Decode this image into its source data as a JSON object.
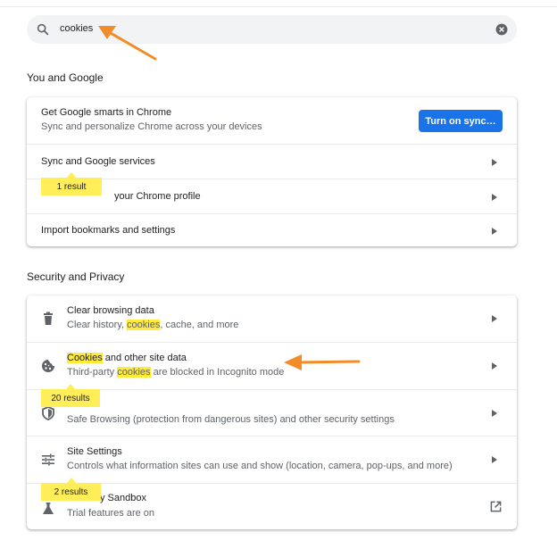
{
  "search": {
    "value": "cookies"
  },
  "you_and_google": {
    "title": "You and Google",
    "sync_card": {
      "title": "Get Google smarts in Chrome",
      "subtitle": "Sync and personalize Chrome across your devices",
      "button": "Turn on sync…"
    },
    "rows": [
      {
        "title": "Sync and Google services"
      },
      {
        "title_visible": "your Chrome profile"
      },
      {
        "title": "Import bookmarks and settings"
      }
    ],
    "bubble": "1 result"
  },
  "security": {
    "title": "Security and Privacy",
    "clear": {
      "title": "Clear browsing data",
      "sub_pre": "Clear history, ",
      "sub_hl": "cookies",
      "sub_post": ", cache, and more"
    },
    "cookies": {
      "title_hl": "Cookies",
      "title_post": " and other site data",
      "sub_pre": "Third-party ",
      "sub_hl": "cookies",
      "sub_post": " are blocked in Incognito mode"
    },
    "security_row": {
      "sub": "Safe Browsing (protection from dangerous sites) and other security settings"
    },
    "site_settings": {
      "title": "Site Settings",
      "sub": "Controls what information sites can use and show (location, camera, pop-ups, and more)"
    },
    "sandbox": {
      "title_visible": "y Sandbox",
      "sub": "Trial features are on"
    },
    "bubbles": [
      "20 results",
      "2 results"
    ]
  },
  "colors": {
    "accent": "#1a73e8",
    "highlight": "#ffeb3b",
    "annotation_arrow": "#f28c28"
  }
}
